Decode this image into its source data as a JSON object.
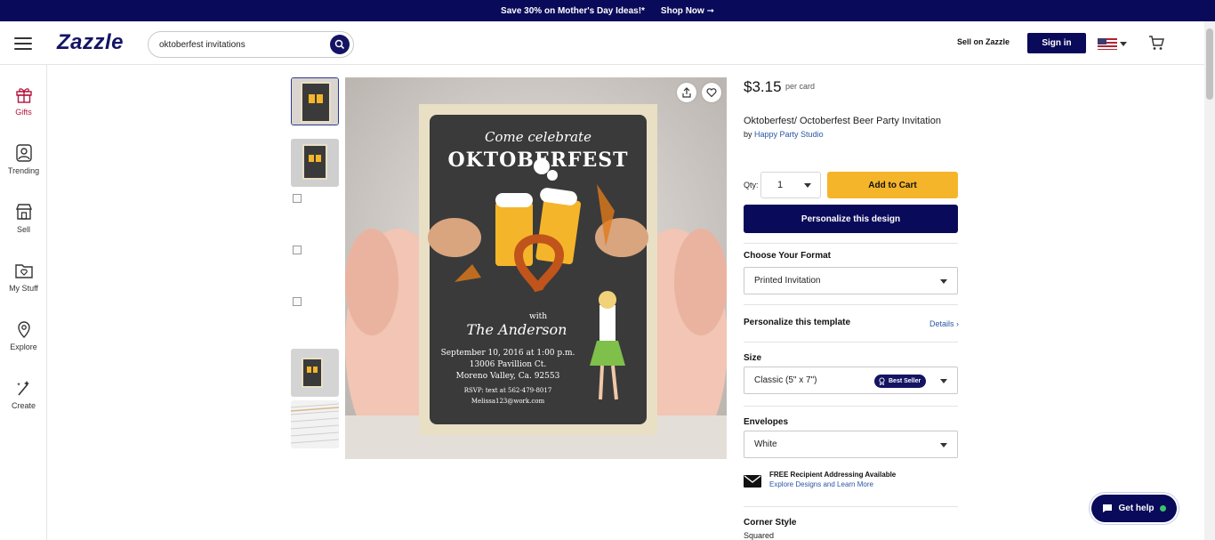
{
  "promo": {
    "text": "Save 30% on Mother's Day Ideas!*",
    "link": "Shop Now ➞"
  },
  "header": {
    "logo": "Zazzle",
    "search": {
      "value": "oktoberfest invitations",
      "placeholder": ""
    },
    "sell": "Sell on Zazzle",
    "signin": "Sign in"
  },
  "sidebar": {
    "items": [
      {
        "label": "Gifts",
        "icon": "gift-icon"
      },
      {
        "label": "Trending",
        "icon": "trending-icon"
      },
      {
        "label": "Sell",
        "icon": "store-icon"
      },
      {
        "label": "My Stuff",
        "icon": "folder-heart-icon"
      },
      {
        "label": "Explore",
        "icon": "location-pin-icon"
      },
      {
        "label": "Create",
        "icon": "magic-wand-icon"
      }
    ]
  },
  "card": {
    "line1": "Come celebrate",
    "title": "OKTOBERFEST",
    "with": "with",
    "name": "The Anderson",
    "date": "September 10, 2016 at 1:00 p.m.",
    "address1": "13006 Pavillion Ct.",
    "address2": "Moreno Valley, Ca. 92553",
    "rsvp": "RSVP: text at 562-479-8017",
    "email": "Melissa123@work.com"
  },
  "product": {
    "price": "$3.15",
    "per": "per card",
    "title": "Oktoberfest/ Octoberfest Beer Party Invitation",
    "by": "by",
    "store": "Happy Party Studio",
    "qty_label": "Qty:",
    "qty_value": "1",
    "add_to_cart": "Add to Cart",
    "personalize_btn": "Personalize this design"
  },
  "options": {
    "format_title": "Choose Your Format",
    "format_value": "Printed Invitation",
    "personalize_title": "Personalize this template",
    "details": "Details ›",
    "size_title": "Size",
    "size_value": "Classic (5\" x 7\")",
    "best_seller": "Best Seller",
    "envelopes_title": "Envelopes",
    "envelopes_value": "White",
    "addressing_title": "FREE Recipient Addressing Available",
    "addressing_link": "Explore Designs and Learn More",
    "corner_title": "Corner Style",
    "corner_value": "Squared"
  },
  "help": {
    "label": "Get help"
  },
  "colors": {
    "navy": "#0a0a5a",
    "accent_yellow": "#f5b52a",
    "gifts_red": "#b3123b",
    "link_blue": "#2a57a3"
  }
}
